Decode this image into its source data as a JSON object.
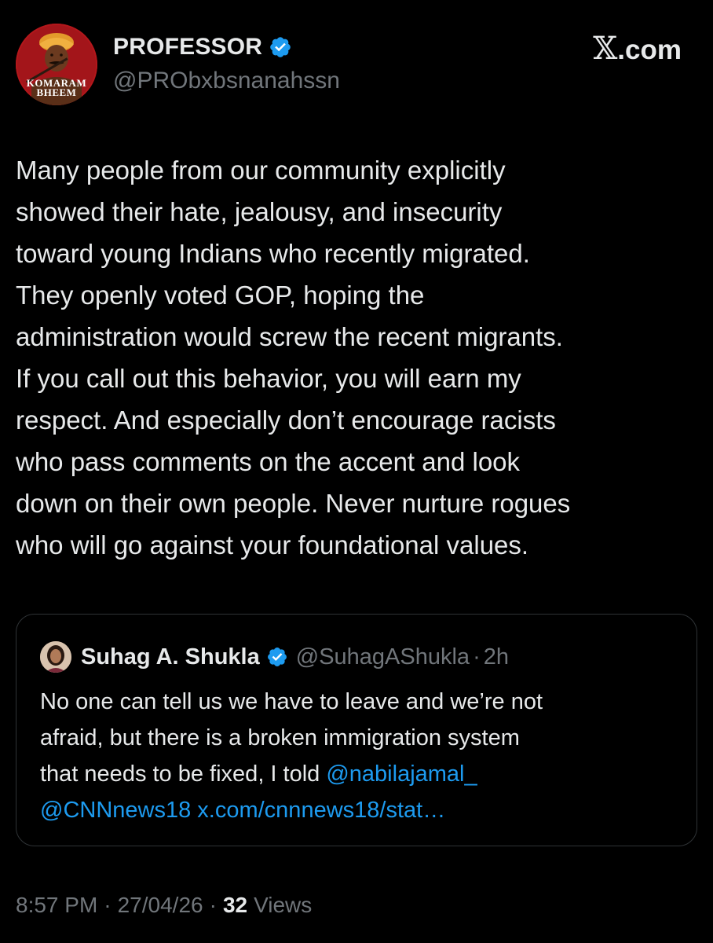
{
  "post": {
    "author": {
      "display_name": "PROFESSOR",
      "handle": "@PRObxbsnanahssn",
      "avatar_caption": [
        "KOMARAM",
        "BHEEM"
      ],
      "verified": true
    },
    "brand": {
      "glyph": "𝕏",
      "text": ".com"
    },
    "body_lines": [
      "Many people from our community explicitly",
      "showed their hate, jealousy, and insecurity",
      "toward young Indians who recently migrated.",
      "They openly voted GOP, hoping the",
      "administration would screw the recent migrants.",
      "If you call out this behavior, you will earn my",
      "respect. And especially don’t encourage racists",
      "who pass comments on the accent and look",
      "down on their own people. Never nurture rogues",
      "who will go against your foundational values."
    ],
    "quoted": {
      "display_name": "Suhag A. Shukla",
      "handle": "@SuhagAShukla",
      "separator": "·",
      "time": "2h",
      "verified": true,
      "lines": [
        {
          "text": "No one can tell us we have to leave and we’re not"
        },
        {
          "text": "afraid, but there is a broken immigration system"
        },
        {
          "text": "that needs to be fixed, I told ",
          "link": "@nabilajamal_"
        },
        {
          "link": "@CNNnews18 x.com/cnnnews18/stat…"
        }
      ]
    },
    "meta": {
      "time": "8:57 PM",
      "date": "27/04/26",
      "separator": "·",
      "views_count": "32",
      "views_label": "Views"
    }
  },
  "colors": {
    "background": "#000000",
    "text_primary": "#e7e9ea",
    "text_secondary": "#71767b",
    "link": "#1d9bf0",
    "verified_badge": "#1d9bf0",
    "border": "#2f3336"
  },
  "icons": {
    "verified": "verified-badge-icon",
    "brand": "x-logo-icon"
  }
}
